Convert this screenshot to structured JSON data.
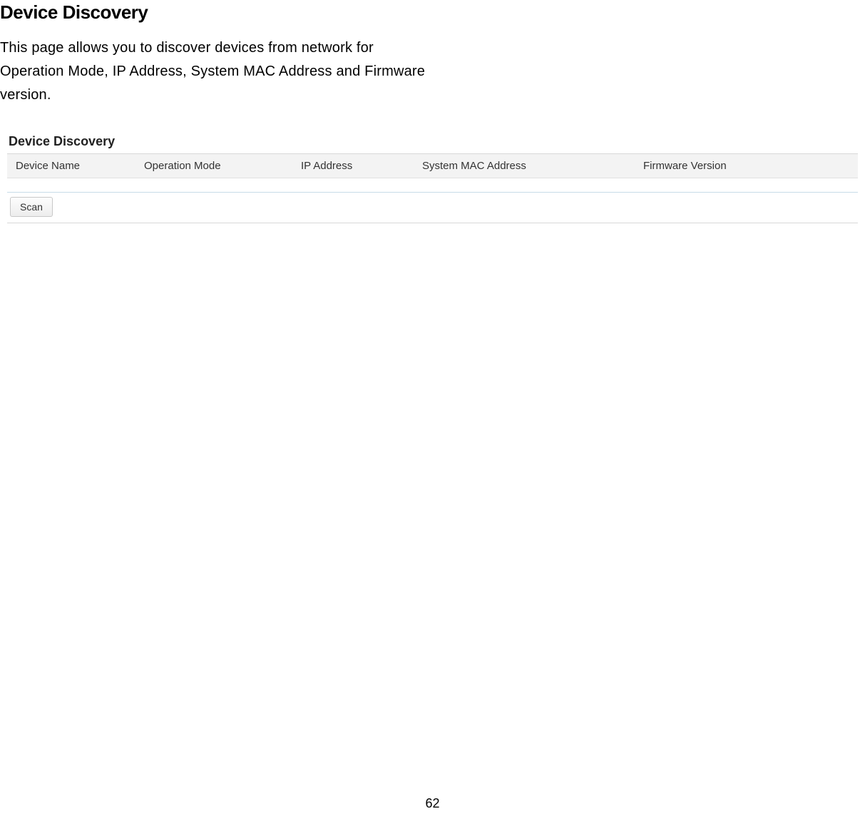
{
  "doc": {
    "title": "Device Discovery",
    "description": "This page allows you to discover devices from network for Operation Mode, IP Address, System MAC Address and Firmware version.",
    "page_number": "62"
  },
  "panel": {
    "title": "Device Discovery",
    "columns": {
      "device_name": "Device Name",
      "operation_mode": "Operation Mode",
      "ip_address": "IP Address",
      "mac_address": "System MAC Address",
      "firmware": "Firmware Version"
    },
    "scan_label": "Scan"
  }
}
